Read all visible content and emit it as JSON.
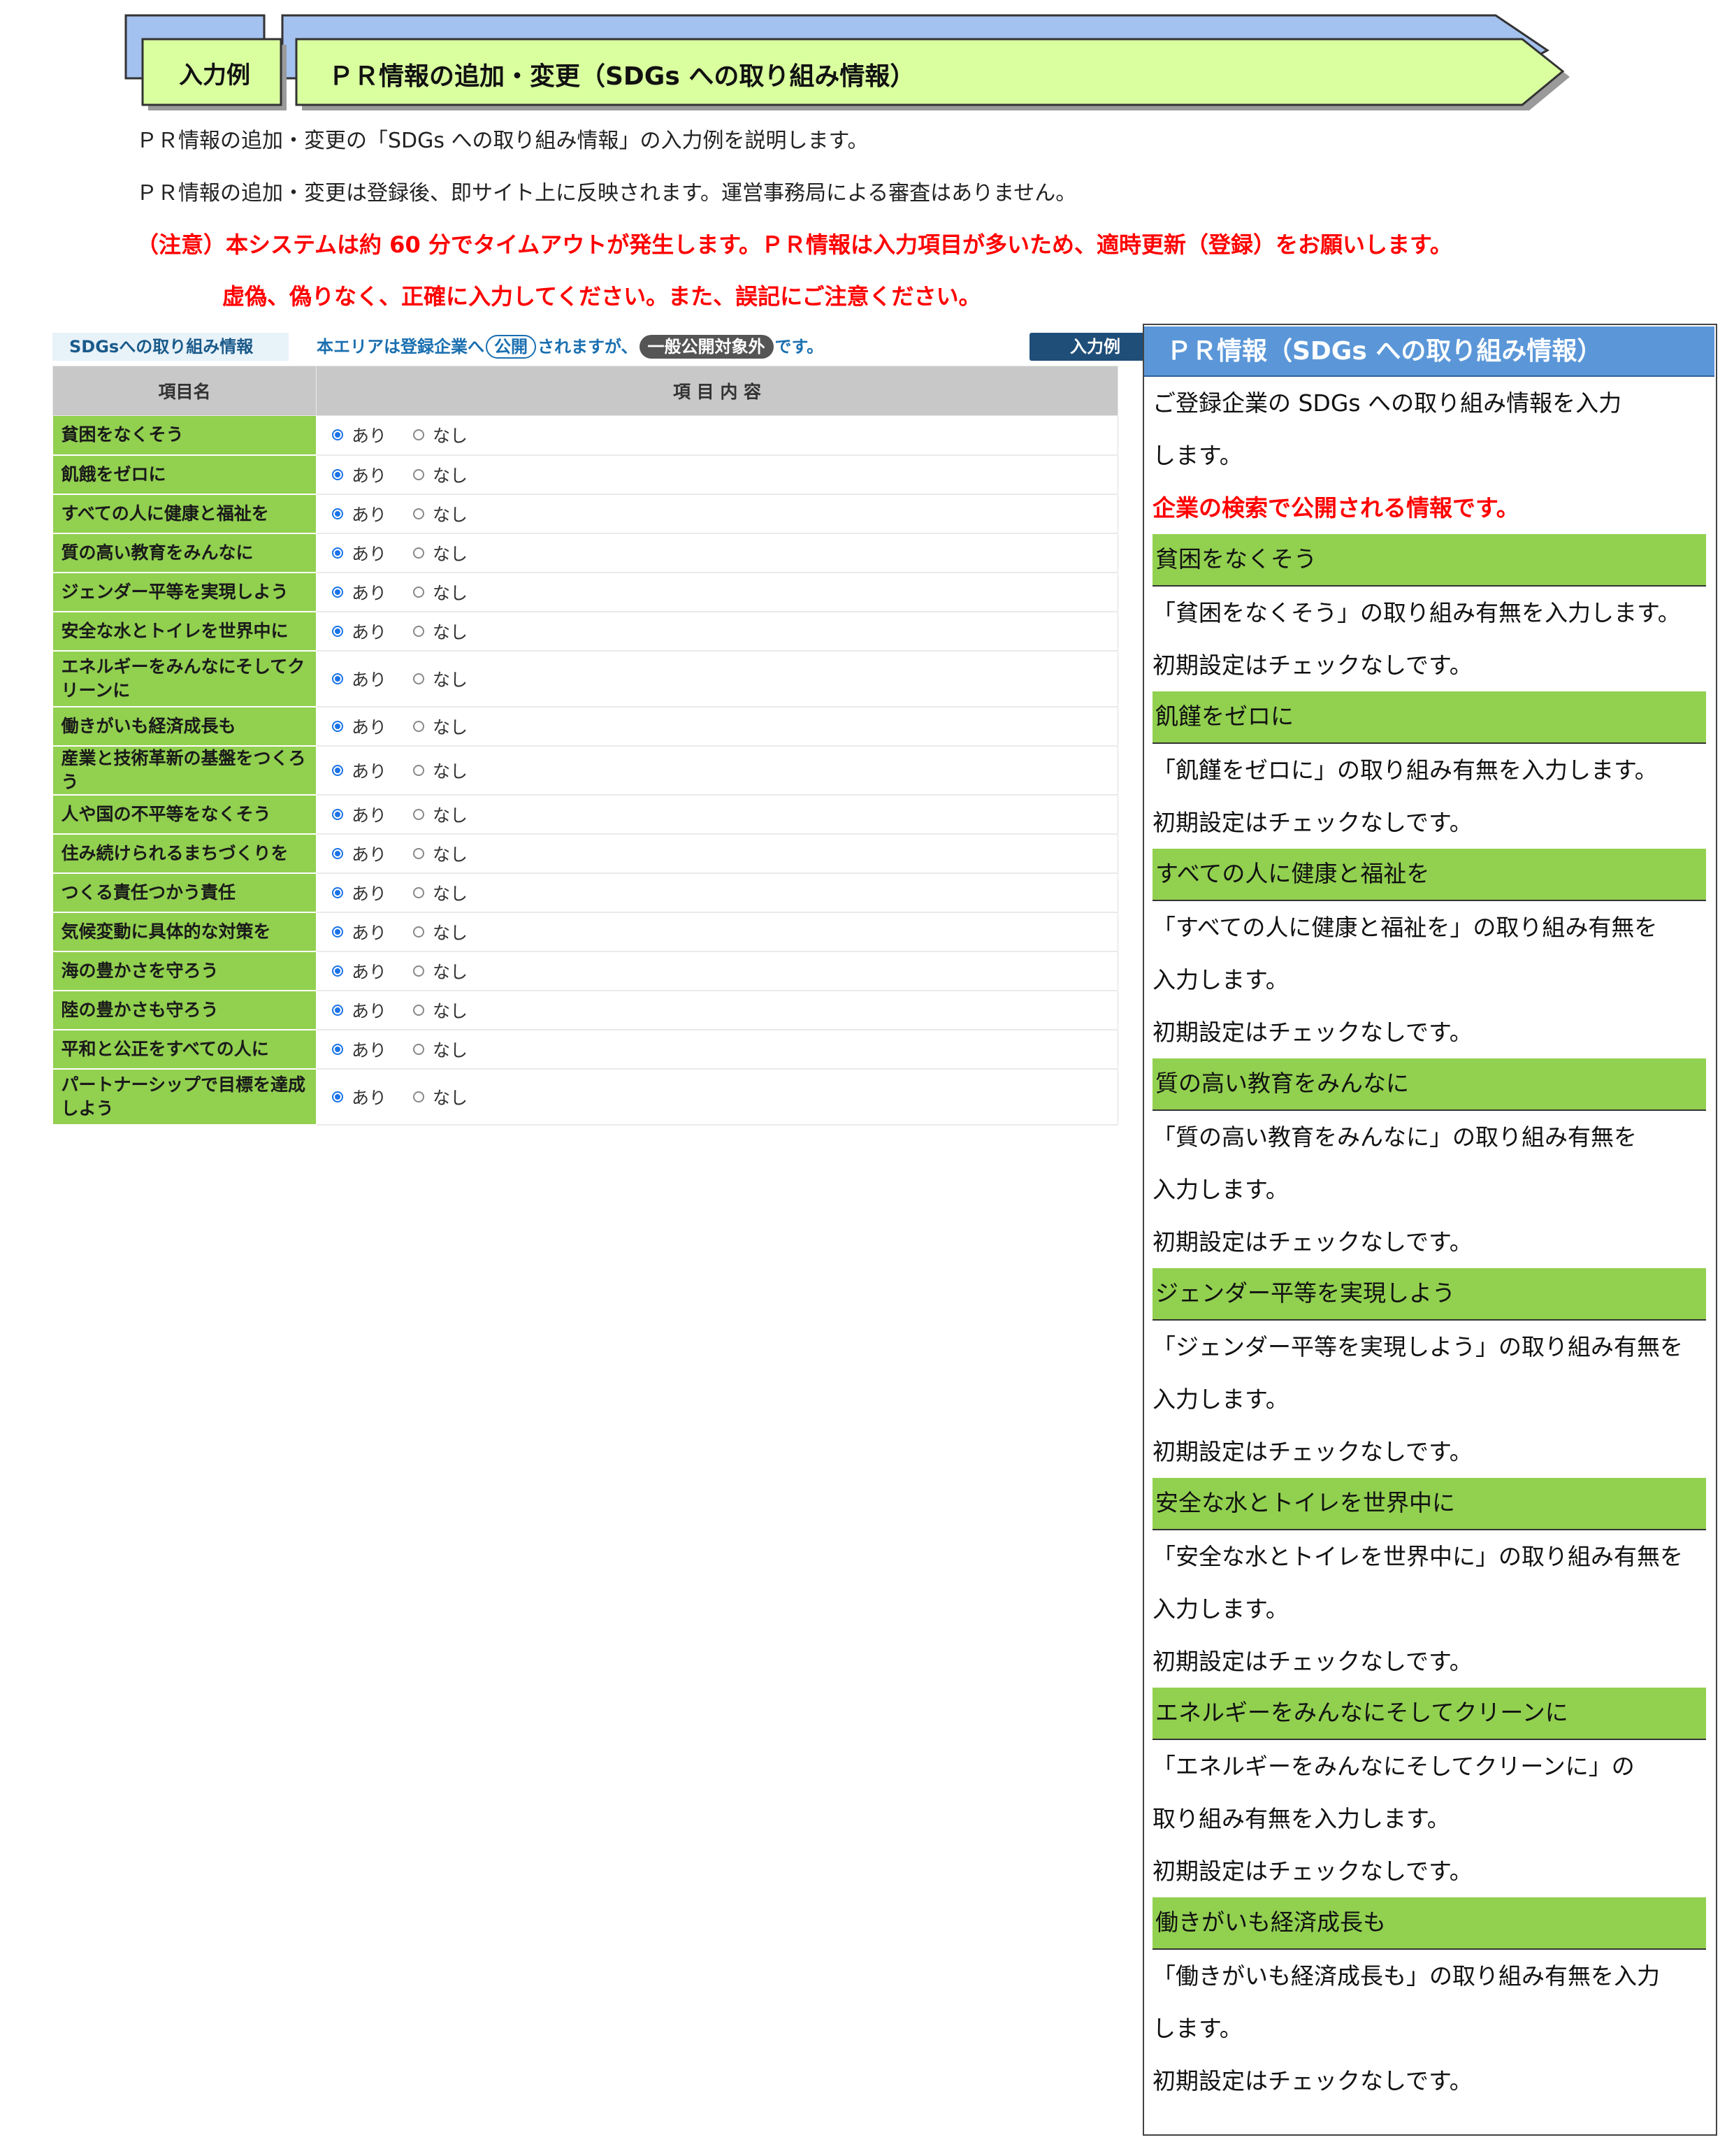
{
  "header": {
    "tag": "入力例",
    "title": "ＰＲ情報の追加・変更（SDGs への取り組み情報）",
    "colors": {
      "blue": "#a4c2ef",
      "green": "#d9ff9f"
    }
  },
  "intro": {
    "line1": "ＰＲ情報の追加・変更の「SDGs への取り組み情報」の入力例を説明します。",
    "line2": "ＰＲ情報の追加・変更は登録後、即サイト上に反映されます。運営事務局による審査はありません。"
  },
  "warning": {
    "line1": "（注意）本システムは約 60 分でタイムアウトが発生します。ＰＲ情報は入力項目が多いため、適時更新（登録）をお願いします。",
    "line2": "虚偽、偽りなく、正確に入力してください。また、誤記にご注意ください。"
  },
  "form": {
    "tab_label": "SDGsへの取り組み情報",
    "note_prefix": "本エリアは登録企業へ",
    "note_public": "公開",
    "note_middle": "されますが、",
    "note_private": "一般公開対象外",
    "note_suffix": "です。",
    "example_button": "入力例",
    "col_name": "項目名",
    "col_content": "項 目 内 容",
    "option_yes": "あり",
    "option_no": "なし",
    "rows": [
      "貧困をなくそう",
      "飢餓をゼロに",
      "すべての人に健康と福祉を",
      "質の高い教育をみんなに",
      "ジェンダー平等を実現しよう",
      "安全な水とトイレを世界中に",
      "エネルギーをみんなにそしてクリーンに",
      "働きがいも経済成長も",
      "産業と技術革新の基盤をつくろう",
      "人や国の不平等をなくそう",
      "住み続けられるまちづくりを",
      "つくる責任つかう責任",
      "気候変動に具体的な対策を",
      "海の豊かさを守ろう",
      "陸の豊かさも守ろう",
      "平和と公正をすべての人に",
      "パートナーシップで目標を達成しよう"
    ]
  },
  "panel": {
    "title": "ＰＲ情報（SDGs への取り組み情報）",
    "intro1": "ご登録企業の SDGs への取り組み情報を入力",
    "intro2": "します。",
    "public_note": "企業の検索で公開される情報です。",
    "default_note": "初期設定はチェックなしです。",
    "sections": [
      {
        "name": "貧困をなくそう",
        "desc": [
          "「貧困をなくそう」の取り組み有無を入力します。"
        ]
      },
      {
        "name": "飢饉をゼロに",
        "desc": [
          "「飢饉をゼロに」の取り組み有無を入力します。"
        ]
      },
      {
        "name": "すべての人に健康と福祉を",
        "desc": [
          "「すべての人に健康と福祉を」の取り組み有無を",
          "入力します。"
        ]
      },
      {
        "name": "質の高い教育をみんなに",
        "desc": [
          "「質の高い教育をみんなに」の取り組み有無を",
          "入力します。"
        ]
      },
      {
        "name": "ジェンダー平等を実現しよう",
        "desc": [
          "「ジェンダー平等を実現しよう」の取り組み有無を",
          "入力します。"
        ]
      },
      {
        "name": "安全な水とトイレを世界中に",
        "desc": [
          "「安全な水とトイレを世界中に」の取り組み有無を",
          "入力します。"
        ]
      },
      {
        "name": "エネルギーをみんなにそしてクリーンに",
        "desc": [
          "「エネルギーをみんなにそしてクリーンに」の",
          "取り組み有無を入力します。"
        ]
      },
      {
        "name": "働きがいも経済成長も",
        "desc": [
          "「働きがいも経済成長も」の取り組み有無を入力",
          "します。"
        ]
      }
    ]
  }
}
